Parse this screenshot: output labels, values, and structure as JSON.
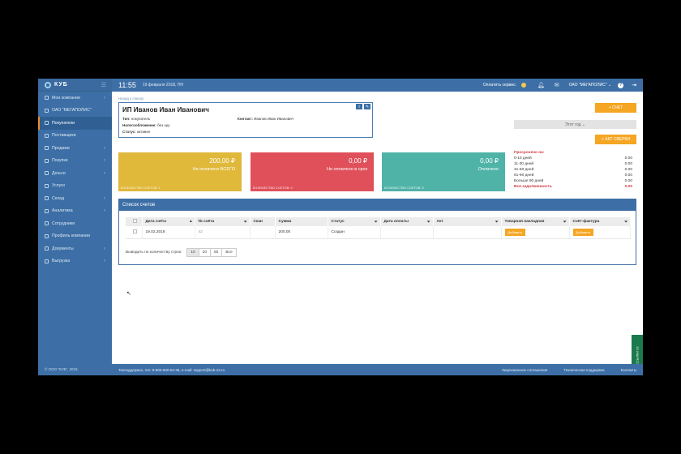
{
  "logo": {
    "text": "КУБ"
  },
  "sidebar": {
    "items": [
      {
        "label": "Мои компании",
        "chevron": true
      },
      {
        "label": "ОАО \"МЕГАПОЛИС\"",
        "chevron": false
      },
      {
        "label": "Покупатели",
        "chevron": false,
        "active": true
      },
      {
        "label": "Поставщики",
        "chevron": false
      },
      {
        "label": "Продажи",
        "chevron": true
      },
      {
        "label": "Покупки",
        "chevron": true
      },
      {
        "label": "Деньги",
        "chevron": true
      },
      {
        "label": "Услуги",
        "chevron": false
      },
      {
        "label": "Склад",
        "chevron": true
      },
      {
        "label": "Аналитика",
        "chevron": true
      },
      {
        "label": "Сотрудники",
        "chevron": false
      },
      {
        "label": "Профиль компании",
        "chevron": false
      },
      {
        "label": "Документы",
        "chevron": true
      },
      {
        "label": "Выгрузка",
        "chevron": true
      }
    ],
    "copyright": "© ООО \"КУБ\", 2018"
  },
  "header": {
    "time": "11:55",
    "date": "19 февраля 2018, ПН",
    "pay_service": "Оплатить сервис:",
    "company": "ОАО \"МЕГАПОЛИС\"",
    "help": "?"
  },
  "breadcrumb": "Назад к списку",
  "customer": {
    "name": "ИП Иванов Иван Иванович",
    "type_label": "Тип:",
    "type_value": "покупатель",
    "tax_label": "Налогообложение:",
    "tax_value": "без ндс",
    "status_label": "Статус:",
    "status_value": "активен",
    "contact_label": "Контакт:",
    "contact_value": "Иванов Иван Иванович"
  },
  "actions": {
    "invoice_button": "+ СЧЕТ",
    "period": "Этот год ⌄",
    "reconciliation_button": "+ АКТ СВЕРКИ"
  },
  "tiles": [
    {
      "amount": "200,00 ₽",
      "label": "Не оплачено ВСЕГО",
      "count": "КОЛИЧЕСТВО СЧЕТОВ: 1",
      "color": "#e0b83a"
    },
    {
      "amount": "0,00 ₽",
      "label": "Не оплачено в срок",
      "count": "КОЛИЧЕСТВО СЧЕТОВ: 0",
      "color": "#e0505a"
    },
    {
      "amount": "0,00 ₽",
      "label": "Оплачено",
      "count": "КОЛИЧЕСТВО СЧЕТОВ: 0",
      "color": "#4fb3a8"
    }
  ],
  "overdue": {
    "title": "Просрочено на:",
    "rows": [
      {
        "label": "0-10 дней",
        "value": "0.00"
      },
      {
        "label": "11-30 дней",
        "value": "0.00"
      },
      {
        "label": "31-60 дней",
        "value": "0.00"
      },
      {
        "label": "61-90 дней",
        "value": "0.00"
      },
      {
        "label": "Больше 90 дней",
        "value": "0.00"
      }
    ],
    "total_label": "Вся задолженность",
    "total_value": "0.00"
  },
  "invoices": {
    "title": "Список счетов",
    "columns": [
      "",
      "Дата счёта",
      "№ счёта",
      "Скан",
      "Сумма",
      "Статус",
      "Дата оплаты",
      "Акт",
      "Товарная накладная",
      "Счёт-фактура"
    ],
    "rows": [
      {
        "date": "19.02.2018",
        "number": "42",
        "scan": "",
        "sum": "200,00",
        "status": "Создан",
        "paid": "",
        "act": "",
        "waybill": "Добавить",
        "factura": "Добавить"
      }
    ],
    "page_size_label": "Выводить по количеству строк:",
    "page_sizes": [
      "10",
      "20",
      "50",
      "Все"
    ]
  },
  "footer": {
    "support": "Техподдержка, тел: 8-800-500-54-36, e-mail: support@kub-24.ru",
    "license": "Лицензионное соглашение",
    "tech": "Техническая поддержка",
    "contacts": "Контакты"
  },
  "side_tab": "ССЫЛКИ 02"
}
